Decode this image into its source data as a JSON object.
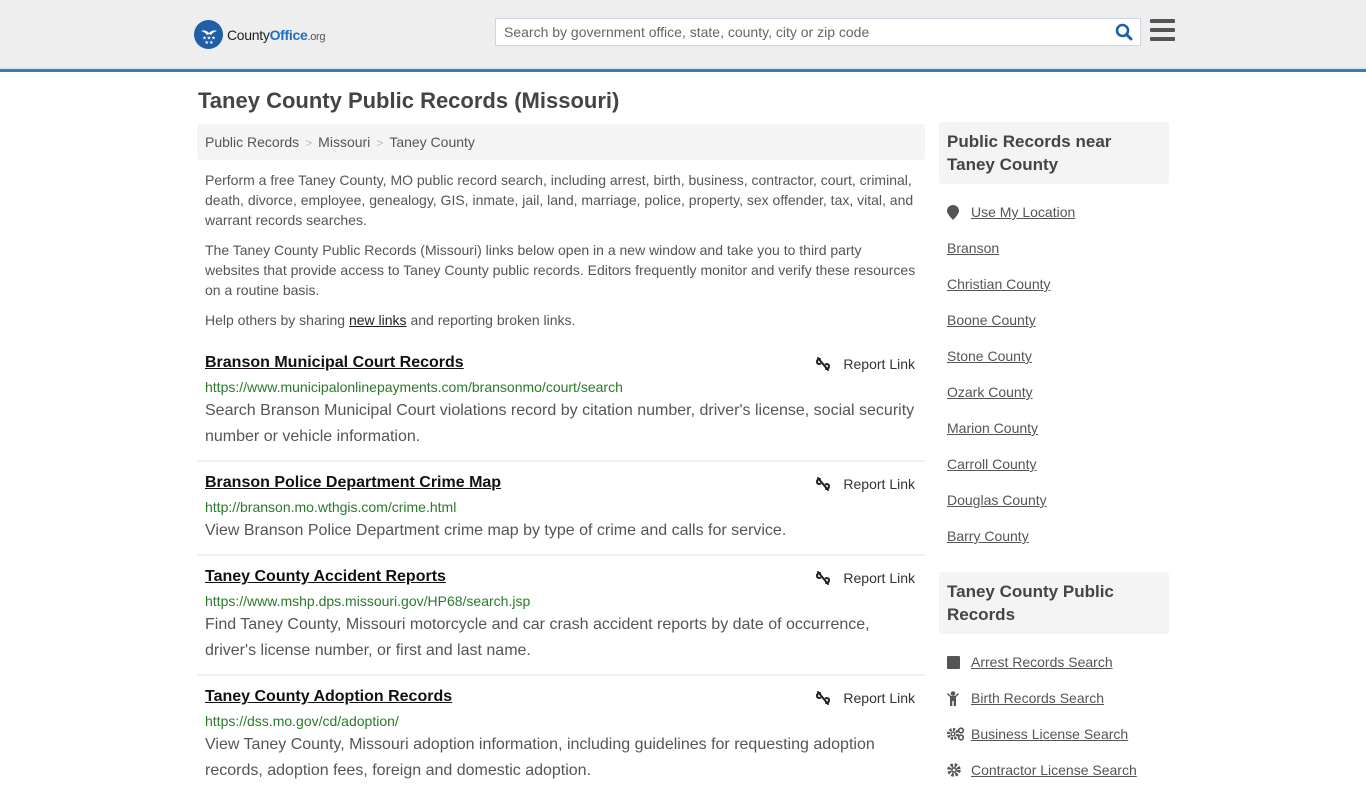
{
  "header": {
    "logo": {
      "county": "County",
      "office": "Office",
      "org": ".org"
    },
    "search": {
      "placeholder": "Search by government office, state, county, city or zip code",
      "value": ""
    },
    "colors": {
      "brand": "#1f6fc0",
      "header_bg": "#eeeeee",
      "accent_border": "#3a7db0"
    }
  },
  "page": {
    "title": "Taney County Public Records (Missouri)"
  },
  "breadcrumb": [
    {
      "label": "Public Records"
    },
    {
      "label": "Missouri"
    },
    {
      "label": "Taney County"
    }
  ],
  "intro": {
    "p1": "Perform a free Taney County, MO public record search, including arrest, birth, business, contractor, court, criminal, death, divorce, employee, genealogy, GIS, inmate, jail, land, marriage, police, property, sex offender, tax, vital, and warrant records searches.",
    "p2": "The Taney County Public Records (Missouri) links below open in a new window and take you to third party websites that provide access to Taney County public records. Editors frequently monitor and verify these resources on a routine basis.",
    "p3_before": "Help others by sharing ",
    "p3_link": "new links",
    "p3_after": " and reporting broken links."
  },
  "records": [
    {
      "title": "Branson Municipal Court Records",
      "url": "https://www.municipalonlinepayments.com/bransonmo/court/search",
      "description": "Search Branson Municipal Court violations record by citation number, driver's license, social security number or vehicle information.",
      "report_label": "Report Link"
    },
    {
      "title": "Branson Police Department Crime Map",
      "url": "http://branson.mo.wthgis.com/crime.html",
      "description": "View Branson Police Department crime map by type of crime and calls for service.",
      "report_label": "Report Link"
    },
    {
      "title": "Taney County Accident Reports",
      "url": "https://www.mshp.dps.missouri.gov/HP68/search.jsp",
      "description": "Find Taney County, Missouri motorcycle and car crash accident reports by date of occurrence, driver's license number, or first and last name.",
      "report_label": "Report Link"
    },
    {
      "title": "Taney County Adoption Records",
      "url": "https://dss.mo.gov/cd/adoption/",
      "description": "View Taney County, Missouri adoption information, including guidelines for requesting adoption records, adoption fees, foreign and domestic adoption.",
      "report_label": "Report Link"
    }
  ],
  "sidebar": {
    "nearby": {
      "heading": "Public Records near Taney County",
      "use_location": {
        "label": "Use My Location",
        "icon": "map-marker-icon"
      },
      "items": [
        {
          "label": "Branson"
        },
        {
          "label": "Christian County"
        },
        {
          "label": "Boone County"
        },
        {
          "label": "Stone County"
        },
        {
          "label": "Ozark County"
        },
        {
          "label": "Marion County"
        },
        {
          "label": "Carroll County"
        },
        {
          "label": "Douglas County"
        },
        {
          "label": "Barry County"
        }
      ]
    },
    "county_records": {
      "heading": "Taney County Public Records",
      "items": [
        {
          "label": "Arrest Records Search",
          "icon": "square-icon"
        },
        {
          "label": "Birth Records Search",
          "icon": "child-icon"
        },
        {
          "label": "Business License Search",
          "icon": "cogs-icon"
        },
        {
          "label": "Contractor License Search",
          "icon": "gear-icon"
        }
      ]
    }
  }
}
